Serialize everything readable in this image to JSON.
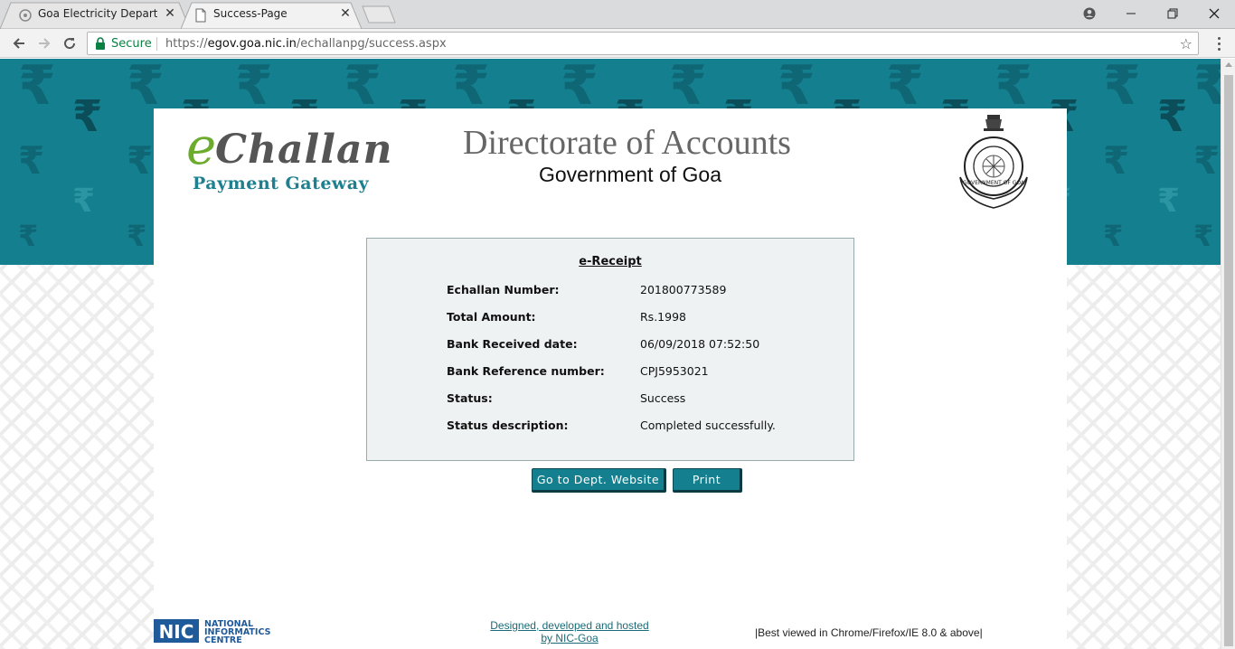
{
  "browser": {
    "tabs": [
      {
        "title": "Goa Electricity Departme",
        "close": "✕"
      },
      {
        "title": "Success-Page",
        "close": "✕"
      }
    ],
    "secure_label": "Secure",
    "url_scheme": "https://",
    "url_host": "egov.goa.nic.in",
    "url_path": "/echallanpg/success.aspx",
    "window_controls": [
      "minimize",
      "restore",
      "close"
    ]
  },
  "header": {
    "logo_e": "e",
    "logo_challan": "Challan",
    "logo_subtitle": "Payment Gateway",
    "title": "Directorate of Accounts",
    "subtitle": "Government of Goa",
    "emblem_text": "GOVERNMENT OF GOA"
  },
  "receipt": {
    "title": "e-Receipt",
    "rows": [
      {
        "label": "Echallan Number:",
        "value": "201800773589"
      },
      {
        "label": "Total Amount:",
        "value": "Rs.1998"
      },
      {
        "label": "Bank Received date:",
        "value": "06/09/2018 07:52:50"
      },
      {
        "label": "Bank Reference number:",
        "value": "CPJ5953021"
      },
      {
        "label": "Status:",
        "value": "Success"
      },
      {
        "label": "Status description:",
        "value": "Completed successfully."
      }
    ]
  },
  "actions": {
    "dept_website": "Go to Dept. Website",
    "print": "Print"
  },
  "footer": {
    "nic_short": "NIC",
    "nic_line1": "NATIONAL",
    "nic_line2": "INFORMATICS",
    "nic_line3": "CENTRE",
    "designed_line1": "Designed, developed and hosted",
    "designed_line2": "by NIC-Goa",
    "best_viewed": "|Best viewed in Chrome/Firefox/IE 8.0 & above|"
  },
  "colors": {
    "brand_teal": "#147f8e",
    "logo_green": "#6cac2d",
    "secure_green": "#0b8043"
  }
}
